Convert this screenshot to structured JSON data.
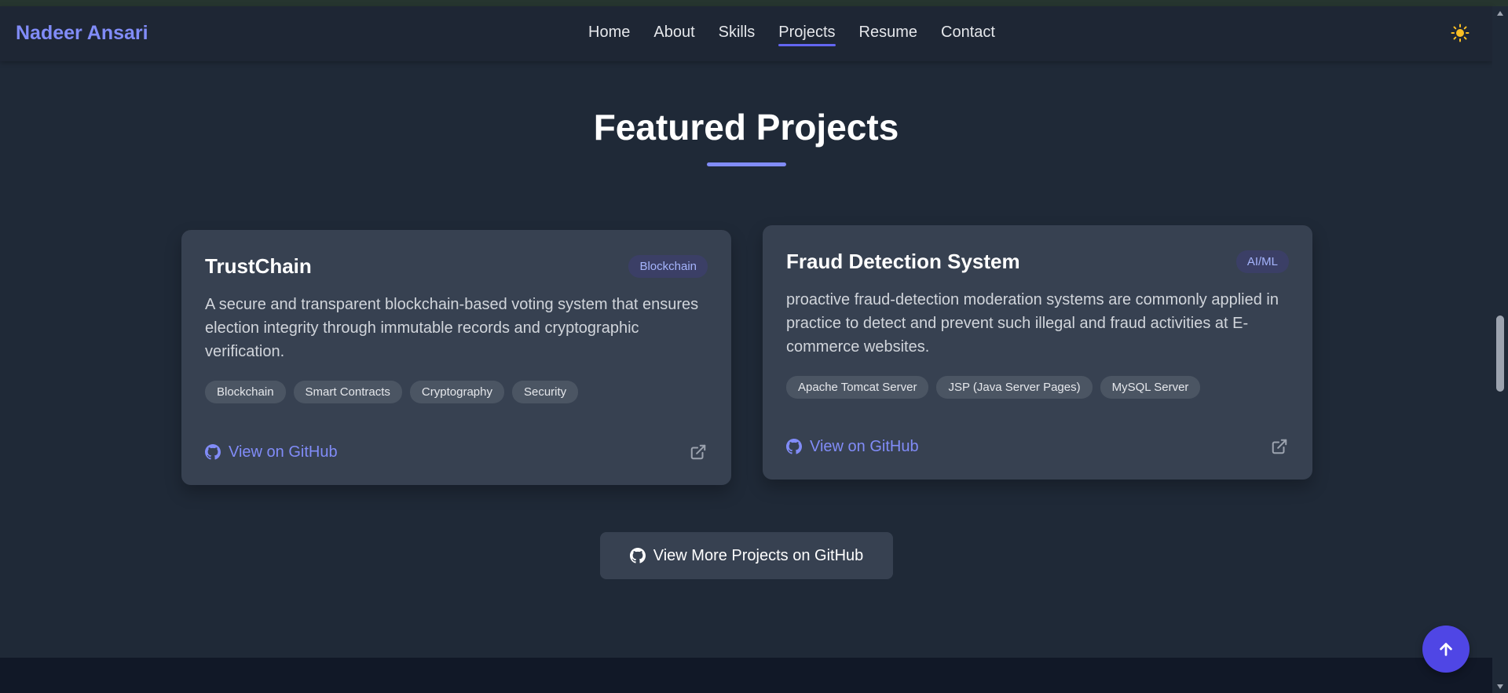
{
  "brand": "Nadeer Ansari",
  "nav": {
    "items": [
      {
        "label": "Home"
      },
      {
        "label": "About"
      },
      {
        "label": "Skills"
      },
      {
        "label": "Projects",
        "active": true
      },
      {
        "label": "Resume"
      },
      {
        "label": "Contact"
      }
    ],
    "theme_icon": "sun-icon"
  },
  "section": {
    "title": "Featured Projects"
  },
  "projects": [
    {
      "title": "TrustChain",
      "category": "Blockchain",
      "description": "A secure and transparent blockchain-based voting system that ensures election integrity through immutable records and cryptographic verification.",
      "tags": [
        "Blockchain",
        "Smart Contracts",
        "Cryptography",
        "Security"
      ],
      "link_label": "View on GitHub"
    },
    {
      "title": "Fraud Detection System",
      "category": "AI/ML",
      "description": "proactive fraud-detection moderation systems are commonly applied in practice to detect and prevent such illegal and fraud activities at E-commerce websites.",
      "tags": [
        "Apache Tomcat Server",
        "JSP (Java Server Pages)",
        "MySQL Server"
      ],
      "link_label": "View on GitHub"
    }
  ],
  "more_button": "View More Projects on GitHub",
  "colors": {
    "accent": "#818cf8",
    "primary_button": "#4f46e5",
    "background": "#1f2937",
    "card": "#374151"
  }
}
